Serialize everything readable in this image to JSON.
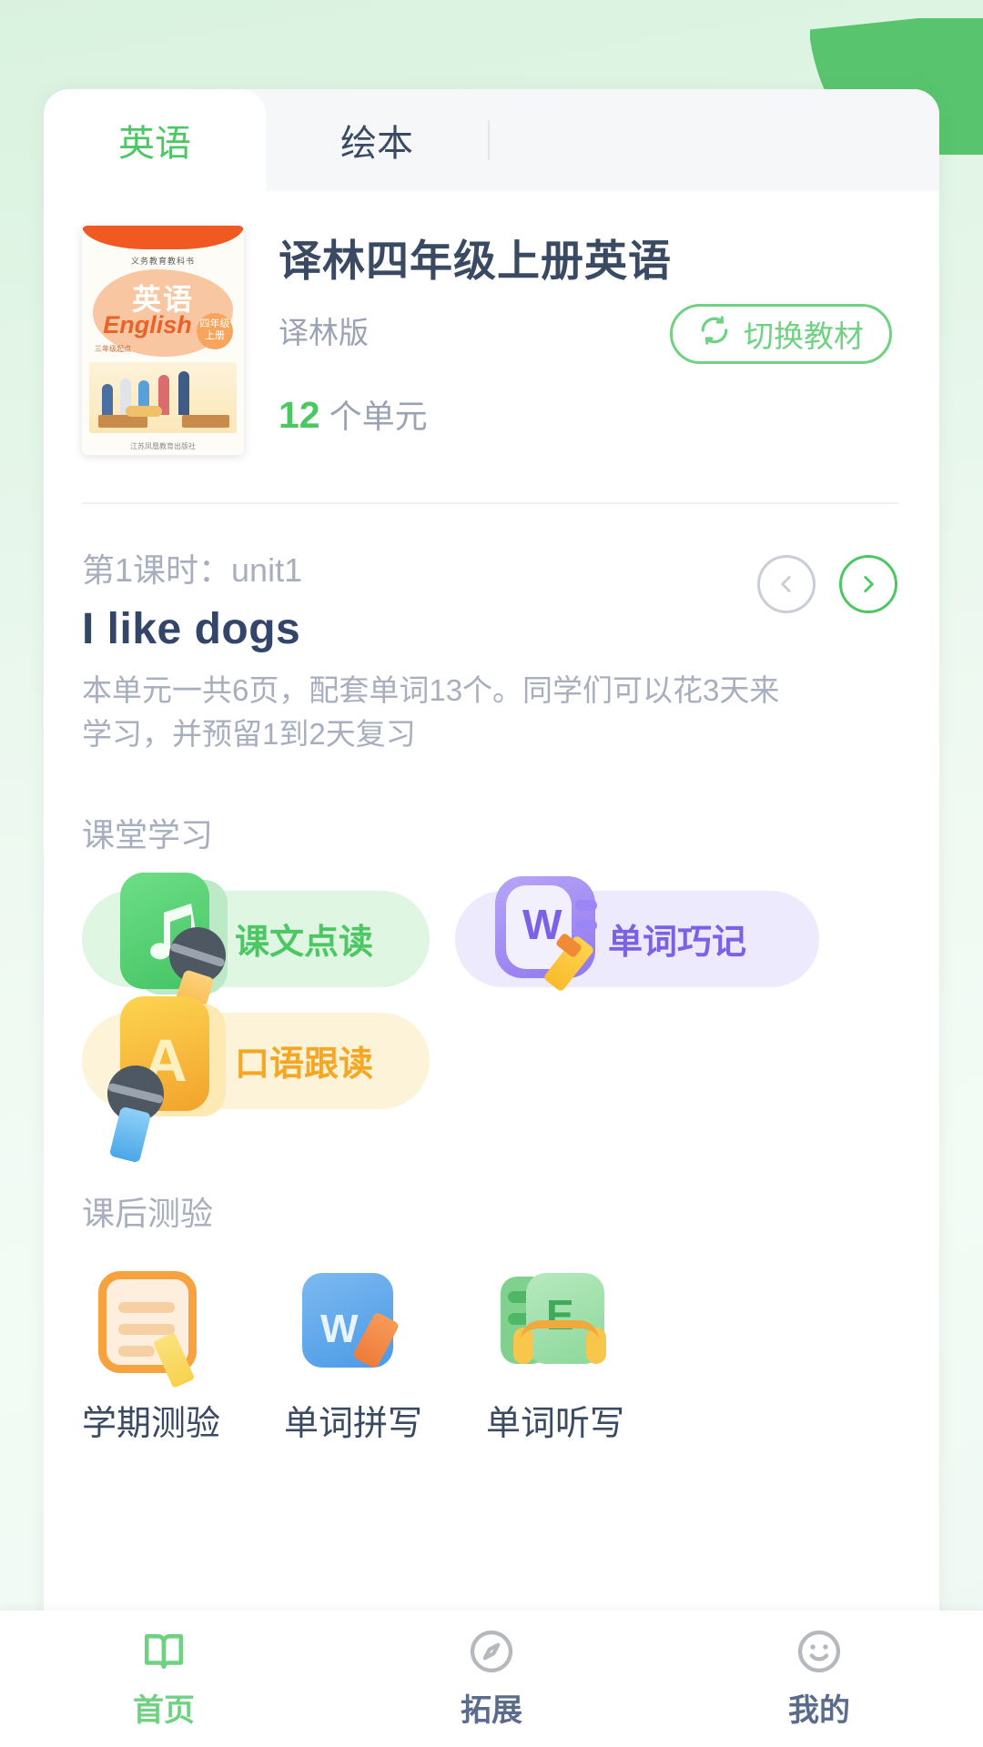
{
  "theme": {
    "accent_green": "#4cc764",
    "accent_green_light": "#6fd182",
    "purple": "#7b61e8",
    "orange": "#f5a623",
    "text_dark": "#3b4a63",
    "text_muted": "#a7aebd",
    "page_bg": "#e6f5ea"
  },
  "tabs": [
    {
      "label": "英语",
      "active": true
    },
    {
      "label": "绘本",
      "active": false
    }
  ],
  "book": {
    "title": "译林四年级上册英语",
    "publisher": "译林版",
    "switch_button_label": "切换教材",
    "switch_button_icon": "refresh-icon",
    "unit_count": "12",
    "unit_suffix": "个单元",
    "cover": {
      "publisher_line": "义务教育教科书",
      "title_cn": "英语",
      "title_en": "English",
      "grade_badge": "四年级\n上册",
      "subtitle": "三年级起点",
      "footer": "江苏凤凰教育出版社"
    }
  },
  "lesson": {
    "kicker": "第1课时：unit1",
    "title": "I like dogs",
    "description": "本单元一共6页，配套单词13个。同学们可以花3天来学习，并预留1到2天复习",
    "prev_icon": "chevron-left-icon",
    "next_icon": "chevron-right-icon",
    "prev_enabled": false,
    "next_enabled": true
  },
  "classroom": {
    "section_title": "课堂学习",
    "items": [
      {
        "label": "课文点读",
        "icon": "music-book-mic-icon",
        "color": "green"
      },
      {
        "label": "单词巧记",
        "icon": "word-card-pencil-icon",
        "color": "purple"
      },
      {
        "label": "口语跟读",
        "icon": "letter-a-mic-icon",
        "color": "yellow"
      }
    ]
  },
  "quiz": {
    "section_title": "课后测验",
    "items": [
      {
        "label": "学期测验",
        "icon": "notebook-pencil-icon",
        "color": "orange"
      },
      {
        "label": "单词拼写",
        "icon": "word-eraser-icon",
        "color": "blue"
      },
      {
        "label": "单词听写",
        "icon": "letter-e-headphone-icon",
        "color": "green"
      }
    ]
  },
  "bottom_nav": {
    "items": [
      {
        "label": "首页",
        "icon": "open-book-icon",
        "active": true
      },
      {
        "label": "拓展",
        "icon": "compass-icon",
        "active": false
      },
      {
        "label": "我的",
        "icon": "smiley-face-icon",
        "active": false
      }
    ]
  }
}
